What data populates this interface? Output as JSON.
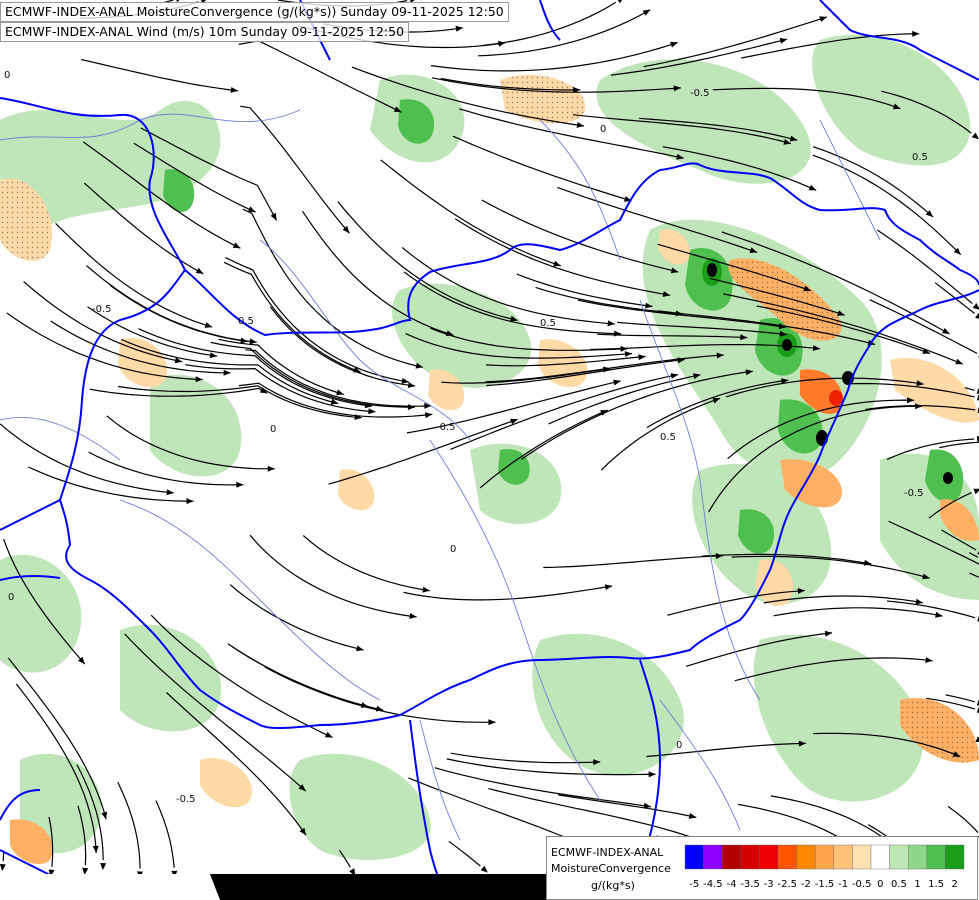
{
  "titles": {
    "line1": "ECMWF-INDEX-ANAL MoistureConvergence (g/(kg*s)) Sunday 09-11-2025 12:50",
    "line2": "ECMWF-INDEX-ANAL Wind (m/s) 10m Sunday 09-11-2025 12:50"
  },
  "legend": {
    "line1": "ECMWF-INDEX-ANAL",
    "line2": "MoistureConvergence",
    "units": "g/(kg*s)",
    "tick_labels": [
      "-5",
      "-4.5",
      "-4",
      "-3.5",
      "-3",
      "-2.5",
      "-2",
      "-1.5",
      "-1",
      "-0.5",
      "0",
      "0.5",
      "1",
      "1.5",
      "2"
    ],
    "colors": [
      "#0000ff",
      "#8b00ff",
      "#b30000",
      "#d40000",
      "#ee0000",
      "#ff5500",
      "#ff8800",
      "#ffa64d",
      "#ffc27a",
      "#ffe0b0",
      "#ffffff",
      "#bde8b4",
      "#8ed68a",
      "#4fbf4f",
      "#1a9e1a"
    ]
  },
  "contour_labels": {
    "values": [
      "0",
      "-0.5",
      "0.5",
      "0",
      "-0.5",
      "0.5",
      "0",
      "-0.5",
      "0.5",
      "0",
      "-0.5",
      "0",
      "0.5",
      "-0.5",
      "0"
    ]
  },
  "map_colors": {
    "border": "#0000ff",
    "rivers": "#6f7fd8",
    "streamlines": "#000000",
    "land_dark": "#bfe6b8"
  }
}
